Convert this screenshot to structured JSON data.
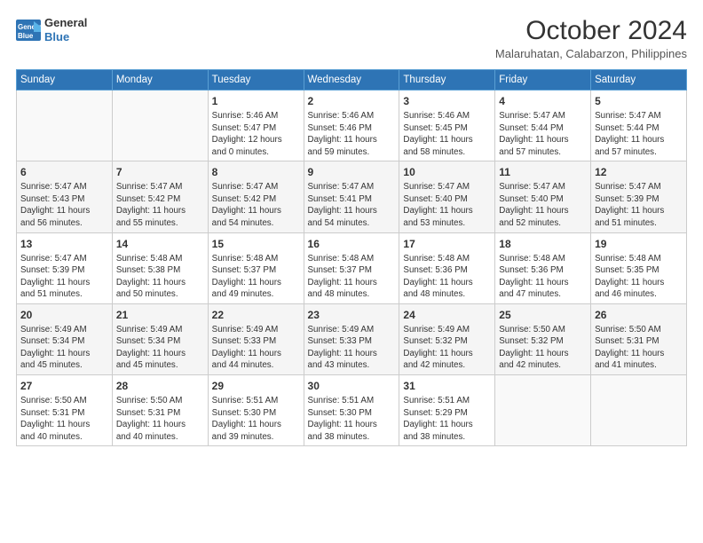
{
  "logo": {
    "line1": "General",
    "line2": "Blue"
  },
  "header": {
    "month": "October 2024",
    "location": "Malaruhatan, Calabarzon, Philippines"
  },
  "days_of_week": [
    "Sunday",
    "Monday",
    "Tuesday",
    "Wednesday",
    "Thursday",
    "Friday",
    "Saturday"
  ],
  "weeks": [
    [
      {
        "day": "",
        "detail": ""
      },
      {
        "day": "",
        "detail": ""
      },
      {
        "day": "1",
        "detail": "Sunrise: 5:46 AM\nSunset: 5:47 PM\nDaylight: 12 hours\nand 0 minutes."
      },
      {
        "day": "2",
        "detail": "Sunrise: 5:46 AM\nSunset: 5:46 PM\nDaylight: 11 hours\nand 59 minutes."
      },
      {
        "day": "3",
        "detail": "Sunrise: 5:46 AM\nSunset: 5:45 PM\nDaylight: 11 hours\nand 58 minutes."
      },
      {
        "day": "4",
        "detail": "Sunrise: 5:47 AM\nSunset: 5:44 PM\nDaylight: 11 hours\nand 57 minutes."
      },
      {
        "day": "5",
        "detail": "Sunrise: 5:47 AM\nSunset: 5:44 PM\nDaylight: 11 hours\nand 57 minutes."
      }
    ],
    [
      {
        "day": "6",
        "detail": "Sunrise: 5:47 AM\nSunset: 5:43 PM\nDaylight: 11 hours\nand 56 minutes."
      },
      {
        "day": "7",
        "detail": "Sunrise: 5:47 AM\nSunset: 5:42 PM\nDaylight: 11 hours\nand 55 minutes."
      },
      {
        "day": "8",
        "detail": "Sunrise: 5:47 AM\nSunset: 5:42 PM\nDaylight: 11 hours\nand 54 minutes."
      },
      {
        "day": "9",
        "detail": "Sunrise: 5:47 AM\nSunset: 5:41 PM\nDaylight: 11 hours\nand 54 minutes."
      },
      {
        "day": "10",
        "detail": "Sunrise: 5:47 AM\nSunset: 5:40 PM\nDaylight: 11 hours\nand 53 minutes."
      },
      {
        "day": "11",
        "detail": "Sunrise: 5:47 AM\nSunset: 5:40 PM\nDaylight: 11 hours\nand 52 minutes."
      },
      {
        "day": "12",
        "detail": "Sunrise: 5:47 AM\nSunset: 5:39 PM\nDaylight: 11 hours\nand 51 minutes."
      }
    ],
    [
      {
        "day": "13",
        "detail": "Sunrise: 5:47 AM\nSunset: 5:39 PM\nDaylight: 11 hours\nand 51 minutes."
      },
      {
        "day": "14",
        "detail": "Sunrise: 5:48 AM\nSunset: 5:38 PM\nDaylight: 11 hours\nand 50 minutes."
      },
      {
        "day": "15",
        "detail": "Sunrise: 5:48 AM\nSunset: 5:37 PM\nDaylight: 11 hours\nand 49 minutes."
      },
      {
        "day": "16",
        "detail": "Sunrise: 5:48 AM\nSunset: 5:37 PM\nDaylight: 11 hours\nand 48 minutes."
      },
      {
        "day": "17",
        "detail": "Sunrise: 5:48 AM\nSunset: 5:36 PM\nDaylight: 11 hours\nand 48 minutes."
      },
      {
        "day": "18",
        "detail": "Sunrise: 5:48 AM\nSunset: 5:36 PM\nDaylight: 11 hours\nand 47 minutes."
      },
      {
        "day": "19",
        "detail": "Sunrise: 5:48 AM\nSunset: 5:35 PM\nDaylight: 11 hours\nand 46 minutes."
      }
    ],
    [
      {
        "day": "20",
        "detail": "Sunrise: 5:49 AM\nSunset: 5:34 PM\nDaylight: 11 hours\nand 45 minutes."
      },
      {
        "day": "21",
        "detail": "Sunrise: 5:49 AM\nSunset: 5:34 PM\nDaylight: 11 hours\nand 45 minutes."
      },
      {
        "day": "22",
        "detail": "Sunrise: 5:49 AM\nSunset: 5:33 PM\nDaylight: 11 hours\nand 44 minutes."
      },
      {
        "day": "23",
        "detail": "Sunrise: 5:49 AM\nSunset: 5:33 PM\nDaylight: 11 hours\nand 43 minutes."
      },
      {
        "day": "24",
        "detail": "Sunrise: 5:49 AM\nSunset: 5:32 PM\nDaylight: 11 hours\nand 42 minutes."
      },
      {
        "day": "25",
        "detail": "Sunrise: 5:50 AM\nSunset: 5:32 PM\nDaylight: 11 hours\nand 42 minutes."
      },
      {
        "day": "26",
        "detail": "Sunrise: 5:50 AM\nSunset: 5:31 PM\nDaylight: 11 hours\nand 41 minutes."
      }
    ],
    [
      {
        "day": "27",
        "detail": "Sunrise: 5:50 AM\nSunset: 5:31 PM\nDaylight: 11 hours\nand 40 minutes."
      },
      {
        "day": "28",
        "detail": "Sunrise: 5:50 AM\nSunset: 5:31 PM\nDaylight: 11 hours\nand 40 minutes."
      },
      {
        "day": "29",
        "detail": "Sunrise: 5:51 AM\nSunset: 5:30 PM\nDaylight: 11 hours\nand 39 minutes."
      },
      {
        "day": "30",
        "detail": "Sunrise: 5:51 AM\nSunset: 5:30 PM\nDaylight: 11 hours\nand 38 minutes."
      },
      {
        "day": "31",
        "detail": "Sunrise: 5:51 AM\nSunset: 5:29 PM\nDaylight: 11 hours\nand 38 minutes."
      },
      {
        "day": "",
        "detail": ""
      },
      {
        "day": "",
        "detail": ""
      }
    ]
  ]
}
